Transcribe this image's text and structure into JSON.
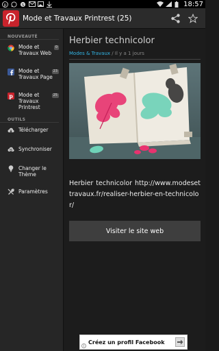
{
  "status_bar": {
    "time": "18:57",
    "left_icons": [
      "pinterest-notification-icon",
      "whatsapp-icon",
      "skype-icon",
      "mail-icon",
      "image-icon",
      "download-icon"
    ],
    "right_icons": [
      "wifi-icon",
      "signal-icon",
      "battery-icon"
    ]
  },
  "action_bar": {
    "title": "Mode et Travaux Printrest (25)",
    "actions": [
      "share-icon",
      "star-icon"
    ]
  },
  "sidebar": {
    "section_new": "NOUVEAUTÉ",
    "feeds": [
      {
        "label": "Mode et Travaux Web",
        "count": "0",
        "icon": "chrome-icon"
      },
      {
        "label": "Mode et Travaux Page",
        "count": "23",
        "icon": "facebook-icon"
      },
      {
        "label": "Mode et Travaux Printrest",
        "count": "25",
        "icon": "pinterest-icon"
      }
    ],
    "section_tools": "OUTILS",
    "tools": [
      {
        "label": "Télécharger",
        "icon": "download-icon"
      },
      {
        "label": "Synchroniser",
        "icon": "sync-icon"
      },
      {
        "label": "Changer le Thème",
        "icon": "bulb-icon"
      },
      {
        "label": "Paramètres",
        "icon": "settings-icon"
      }
    ]
  },
  "post": {
    "title": "Herbier technicolor",
    "category": "Modes & Travaux",
    "meta_sep": " / ",
    "time_ago": "Il y a 1 jours",
    "body": "Herbier technicolor http://www.modesettravaux.fr/realiser-herbier-en-technicolor/",
    "visit_label": "Visiter le site web"
  },
  "ad": {
    "label": "Créez un profil Facebook"
  },
  "colors": {
    "accent": "#33b5e5",
    "pinterest_red": "#c8232c"
  }
}
